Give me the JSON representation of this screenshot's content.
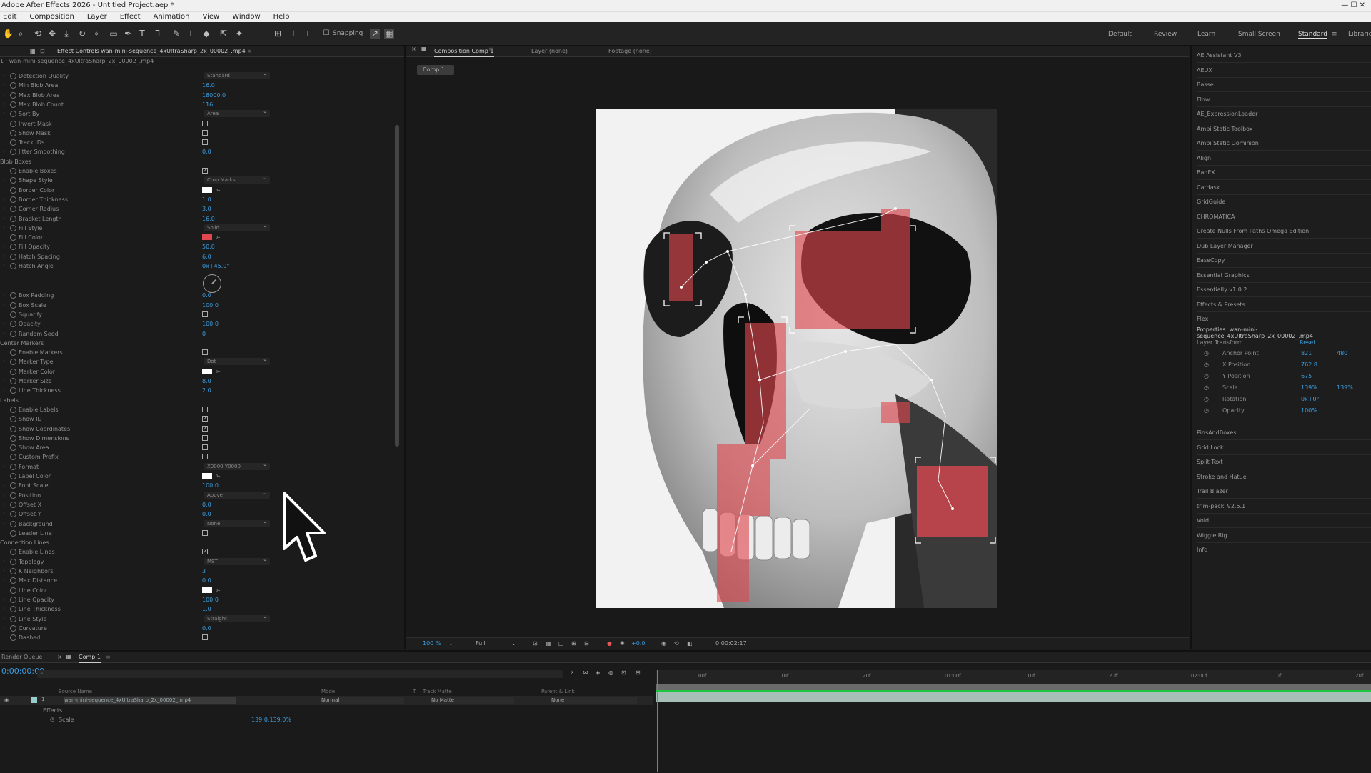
{
  "window": {
    "title": "Adobe After Effects 2026 - Untitled Project.aep *",
    "controls": "—  ☐  ✕"
  },
  "menu": [
    "Edit",
    "Composition",
    "Layer",
    "Effect",
    "Animation",
    "View",
    "Window",
    "Help"
  ],
  "toolbar": {
    "snapping_label": "Snapping",
    "workspaces": [
      "Default",
      "Review",
      "Learn",
      "Small Screen",
      "Standard"
    ],
    "libraries": "Libraries"
  },
  "effect_panel": {
    "tab_title": "Effect Controls wan-mini-sequence_4xUltraSharp_2x_00002_.mp4",
    "layer_path": "1 · wan-mini-sequence_4xUltraSharp_2x_00002_.mp4",
    "hatch_angle_value": "0x+45.0°"
  },
  "rows": [
    {
      "label": "Detection Quality",
      "kind": "dd",
      "value": "Standard"
    },
    {
      "label": "Min Blob Area",
      "kind": "num",
      "value": "16.0"
    },
    {
      "label": "Max Blob Area",
      "kind": "num",
      "value": "18000.0"
    },
    {
      "label": "Max Blob Count",
      "kind": "num",
      "value": "116"
    },
    {
      "label": "Sort By",
      "kind": "dd",
      "value": "Area"
    },
    {
      "label": "Invert Mask",
      "kind": "cb",
      "value": ""
    },
    {
      "label": "Show Mask",
      "kind": "cb",
      "value": ""
    },
    {
      "label": "Track IDs",
      "kind": "cb",
      "value": ""
    },
    {
      "label": "Jitter Smoothing",
      "kind": "num",
      "value": "0.0"
    },
    {
      "label": "Blob Boxes",
      "kind": "grp",
      "value": ""
    },
    {
      "label": "Enable Boxes",
      "kind": "cb",
      "value": "✓"
    },
    {
      "label": "Shape Style",
      "kind": "dd",
      "value": "Crop Marks"
    },
    {
      "label": "Border Color",
      "kind": "color",
      "value": "#ffffff"
    },
    {
      "label": "Border Thickness",
      "kind": "num",
      "value": "1.0"
    },
    {
      "label": "Corner Radius",
      "kind": "num",
      "value": "3.0"
    },
    {
      "label": "Bracket Length",
      "kind": "num",
      "value": "16.0"
    },
    {
      "label": "Fill Style",
      "kind": "dd",
      "value": "Solid"
    },
    {
      "label": "Fill Color",
      "kind": "color",
      "value": "#e0474f"
    },
    {
      "label": "Fill Opacity",
      "kind": "num",
      "value": "50.0"
    },
    {
      "label": "Hatch Spacing",
      "kind": "num",
      "value": "6.0"
    },
    {
      "label": "Hatch Angle",
      "kind": "num",
      "value": "0x+45.0°"
    },
    {
      "label": "Box Padding",
      "kind": "num",
      "value": "0.0"
    },
    {
      "label": "Box Scale",
      "kind": "num",
      "value": "100.0"
    },
    {
      "label": "Squarify",
      "kind": "cb",
      "value": ""
    },
    {
      "label": "Opacity",
      "kind": "num",
      "value": "100.0"
    },
    {
      "label": "Random Seed",
      "kind": "num",
      "value": "0"
    },
    {
      "label": "Center Markers",
      "kind": "grp",
      "value": ""
    },
    {
      "label": "Enable Markers",
      "kind": "cb",
      "value": ""
    },
    {
      "label": "Marker Type",
      "kind": "dd",
      "value": "Dot"
    },
    {
      "label": "Marker Color",
      "kind": "color",
      "value": "#ffffff"
    },
    {
      "label": "Marker Size",
      "kind": "num",
      "value": "8.0"
    },
    {
      "label": "Line Thickness",
      "kind": "num",
      "value": "2.0"
    },
    {
      "label": "Labels",
      "kind": "grp",
      "value": ""
    },
    {
      "label": "Enable Labels",
      "kind": "cb",
      "value": ""
    },
    {
      "label": "Show ID",
      "kind": "cb",
      "value": "✓"
    },
    {
      "label": "Show Coordinates",
      "kind": "cb",
      "value": "✓"
    },
    {
      "label": "Show Dimensions",
      "kind": "cb",
      "value": ""
    },
    {
      "label": "Show Area",
      "kind": "cb",
      "value": ""
    },
    {
      "label": "Custom Prefix",
      "kind": "cb",
      "value": ""
    },
    {
      "label": "Format",
      "kind": "dd",
      "value": "X0000 Y0000"
    },
    {
      "label": "Label Color",
      "kind": "color",
      "value": "#ffffff"
    },
    {
      "label": "Font Scale",
      "kind": "num",
      "value": "100.0"
    },
    {
      "label": "Position",
      "kind": "dd",
      "value": "Above"
    },
    {
      "label": "Offset X",
      "kind": "num",
      "value": "0.0"
    },
    {
      "label": "Offset Y",
      "kind": "num",
      "value": "0.0"
    },
    {
      "label": "Background",
      "kind": "dd",
      "value": "None"
    },
    {
      "label": "Leader Line",
      "kind": "cb",
      "value": ""
    },
    {
      "label": "Connection Lines",
      "kind": "grp",
      "value": ""
    },
    {
      "label": "Enable Lines",
      "kind": "cb",
      "value": "✓"
    },
    {
      "label": "Topology",
      "kind": "dd",
      "value": "MST"
    },
    {
      "label": "K Neighbors",
      "kind": "num",
      "value": "3"
    },
    {
      "label": "Max Distance",
      "kind": "num",
      "value": "0.0"
    },
    {
      "label": "Line Color",
      "kind": "color",
      "value": "#ffffff"
    },
    {
      "label": "Line Opacity",
      "kind": "num",
      "value": "100.0"
    },
    {
      "label": "Line Thickness",
      "kind": "num",
      "value": "1.0"
    },
    {
      "label": "Line Style",
      "kind": "dd",
      "value": "Straight"
    },
    {
      "label": "Curvature",
      "kind": "num",
      "value": "0.0"
    },
    {
      "label": "Dashed",
      "kind": "cb",
      "value": ""
    }
  ],
  "comp": {
    "tab": "Composition Comp 1",
    "layer_tab": "Layer (none)",
    "footage_tab": "Footage (none)",
    "crumb": "Comp 1",
    "zoom": "100 %",
    "resolution": "Full",
    "exposure": "+0.0",
    "timecode": "0:00:02:17"
  },
  "right_panel": {
    "items": [
      "AE Assistant V3",
      "AEUX",
      "Basse",
      "Flow",
      "AE_ExpressionLoader",
      "Ambi Static Toolbox",
      "Ambi Static Dominion",
      "Align",
      "BadFX",
      "Cardask",
      "GridGuide",
      "CHROMATICA",
      "Create Nulls From Paths Omega Edition",
      "Dub Layer Manager",
      "EaseCopy",
      "Essential Graphics",
      "Essentially v1.0.2",
      "Effects & Presets",
      "Flex"
    ],
    "properties_title": "Properties: wan-mini-sequence_4xUltraSharp_2x_00002_.mp4",
    "layer_transform": "Layer Transform",
    "reset": "Reset",
    "props": [
      {
        "label": "Anchor Point",
        "v1": "821",
        "v2": "480"
      },
      {
        "label": "X Position",
        "v1": "762.8",
        "v2": ""
      },
      {
        "label": "Y Position",
        "v1": "675",
        "v2": ""
      },
      {
        "label": "Scale",
        "v1": "139%",
        "v2": "139%"
      },
      {
        "label": "Rotation",
        "v1": "0x+0°",
        "v2": ""
      },
      {
        "label": "Opacity",
        "v1": "100%",
        "v2": ""
      }
    ],
    "items2": [
      "PinsAndBoxes",
      "Grid Lock",
      "Split Text",
      "Stroke and Hatue",
      "Trail Blazer",
      "trim-pack_V2.5.1",
      "Void",
      "Wiggle Rig",
      "Info"
    ]
  },
  "timeline": {
    "tab1": "Render Queue",
    "tab2": "Comp 1",
    "timecode": "0:00:00:00",
    "headers": [
      "Source Name",
      "Mode",
      "T",
      "Track Matte",
      "Parent & Link"
    ],
    "layer_number": "1",
    "layer_name": "wan-mini-sequence_4xUltraSharp_2x_00002_.mp4",
    "mode": "Normal",
    "matte": "No Matte",
    "parent": "None",
    "effects_label": "Effects",
    "scale_label": "Scale",
    "scale_value": "139.0,139.0%",
    "ruler": [
      "00f",
      "10f",
      "20f",
      "01:00f",
      "10f",
      "20f",
      "02:00f",
      "10f",
      "20f"
    ]
  }
}
